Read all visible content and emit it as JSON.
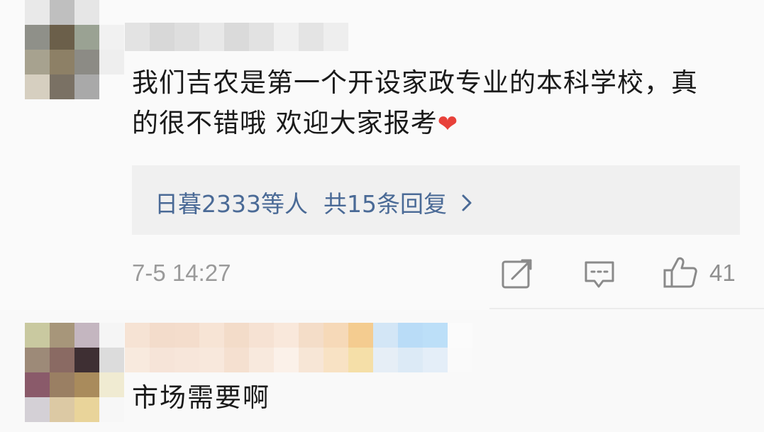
{
  "comments": [
    {
      "text": "我们吉农是第一个开设家政专业的本科学校，真的很不错哦 欢迎大家报考",
      "emoji": "❤",
      "replies": {
        "users": "日暮2333等人",
        "total": "共15条回复"
      },
      "timestamp": "7-5 14:27",
      "like_count": "41"
    },
    {
      "text": "市场需要啊"
    }
  ],
  "icons": {
    "repost": "repost-icon",
    "comment": "comment-icon",
    "like": "thumbs-up-icon",
    "chevron": "chevron-right-icon"
  },
  "colors": {
    "link": "#4a6a96",
    "heart": "#e8413a",
    "muted": "#9a9a9a"
  }
}
